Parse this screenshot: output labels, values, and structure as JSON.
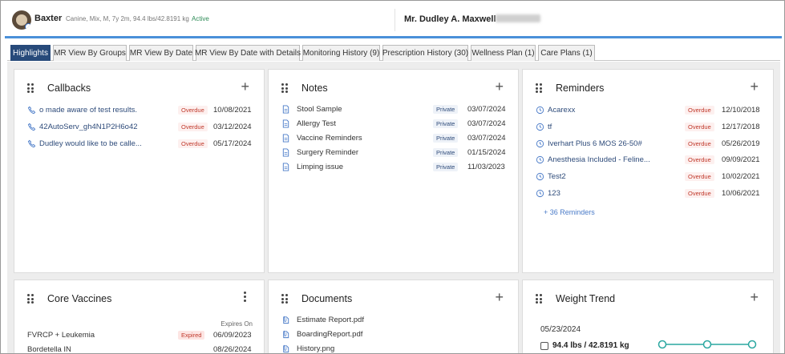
{
  "header": {
    "pet_name": "Baxter",
    "pet_meta": "Canine, Mix, M, 7y 2m, 94.4 lbs/42.8191 kg",
    "pet_status": "Active",
    "owner_name": "Mr. Dudley A. Maxwell"
  },
  "tabs": [
    {
      "label": "Highlights",
      "active": true
    },
    {
      "label": "MR View By Groups"
    },
    {
      "label": "MR View By Date"
    },
    {
      "label": "MR View By Date with Details"
    },
    {
      "label": "Monitoring History (9)"
    },
    {
      "label": "Prescription History (30)"
    },
    {
      "label": "Wellness Plan (1)"
    },
    {
      "label": "Care Plans (1)"
    }
  ],
  "callbacks": {
    "title": "Callbacks",
    "items": [
      {
        "text": "o made aware of test results.",
        "status": "Overdue",
        "date": "10/08/2021"
      },
      {
        "text": "42AutoServ_gh4N1P2H6o42",
        "status": "Overdue",
        "date": "03/12/2024"
      },
      {
        "text": "Dudley would like to be calle...",
        "status": "Overdue",
        "date": "05/17/2024"
      }
    ]
  },
  "notes": {
    "title": "Notes",
    "items": [
      {
        "text": "Stool Sample",
        "status": "Private",
        "date": "03/07/2024"
      },
      {
        "text": "Allergy Test",
        "status": "Private",
        "date": "03/07/2024"
      },
      {
        "text": "Vaccine Reminders",
        "status": "Private",
        "date": "03/07/2024"
      },
      {
        "text": "Surgery Reminder",
        "status": "Private",
        "date": "01/15/2024"
      },
      {
        "text": "Limping issue",
        "status": "Private",
        "date": "11/03/2023"
      }
    ]
  },
  "reminders": {
    "title": "Reminders",
    "items": [
      {
        "text": "Acarexx",
        "status": "Overdue",
        "date": "12/10/2018"
      },
      {
        "text": "tf",
        "status": "Overdue",
        "date": "12/17/2018"
      },
      {
        "text": "Iverhart Plus 6 MOS 26-50#",
        "status": "Overdue",
        "date": "05/26/2019"
      },
      {
        "text": "Anesthesia Included - Feline...",
        "status": "Overdue",
        "date": "09/09/2021"
      },
      {
        "text": "Test2",
        "status": "Overdue",
        "date": "10/02/2021"
      },
      {
        "text": "123",
        "status": "Overdue",
        "date": "10/06/2021"
      }
    ],
    "more_label": "+ 36 Reminders"
  },
  "core_vaccines": {
    "title": "Core Vaccines",
    "expires_header": "Expires On",
    "items": [
      {
        "text": "FVRCP + Leukemia",
        "status": "Expired",
        "date": "06/09/2023"
      },
      {
        "text": "Bordetella IN",
        "status": "",
        "date": "08/26/2024"
      }
    ]
  },
  "documents": {
    "title": "Documents",
    "items": [
      {
        "text": "Estimate Report.pdf"
      },
      {
        "text": "BoardingReport.pdf"
      },
      {
        "text": "History.png"
      }
    ]
  },
  "weight_trend": {
    "title": "Weight Trend",
    "date": "05/23/2024",
    "value": "94.4 lbs / 42.8191 kg"
  },
  "icons": {
    "callback": "phone-icon",
    "note": "document-icon",
    "reminder": "clock-icon",
    "document": "attachment-icon",
    "drag": "drag-handle-icon",
    "add": "plus-icon",
    "more": "kebab-menu-icon"
  },
  "colors": {
    "accent": "#274a7a",
    "header_line": "#4a90d9",
    "link": "#2e4b7a",
    "overdue": "#c0392b",
    "active": "#2e8b57"
  }
}
